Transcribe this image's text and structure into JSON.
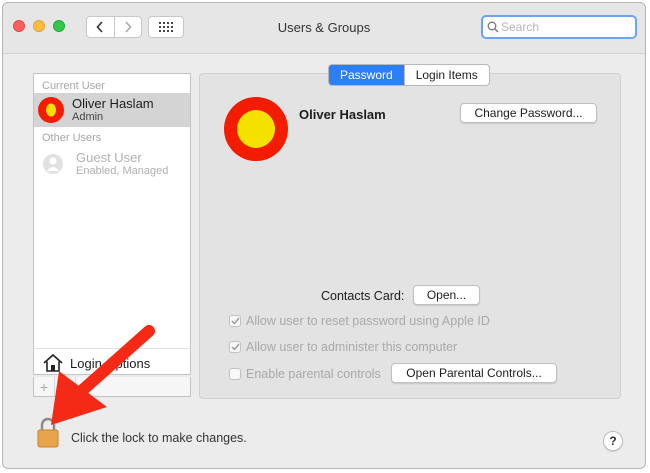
{
  "window": {
    "title": "Users & Groups"
  },
  "search": {
    "placeholder": "Search",
    "value": ""
  },
  "sidebar": {
    "current_header": "Current User",
    "current_user": {
      "name": "Oliver Haslam",
      "role": "Admin"
    },
    "other_header": "Other Users",
    "other_users": [
      {
        "name": "Guest User",
        "role": "Enabled, Managed"
      }
    ],
    "login_options": "Login Options",
    "add_symbol": "+",
    "remove_symbol": "−"
  },
  "tabs": [
    {
      "label": "Password",
      "active": true
    },
    {
      "label": "Login Items",
      "active": false
    }
  ],
  "detail": {
    "user_name": "Oliver Haslam",
    "change_password": "Change Password...",
    "contacts_label": "Contacts Card:",
    "open_button": "Open...",
    "options": [
      {
        "label": "Allow user to reset password using Apple ID",
        "checked": true
      },
      {
        "label": "Allow user to administer this computer",
        "checked": true
      },
      {
        "label": "Enable parental controls",
        "checked": false
      }
    ],
    "parental_button": "Open Parental Controls..."
  },
  "footer": {
    "lock_text": "Click the lock to make changes.",
    "help": "?"
  },
  "icons": {
    "close": "close-button",
    "minimize": "minimize-button",
    "zoom": "zoom-button",
    "back": "chevron-left-icon",
    "forward": "chevron-right-icon",
    "grid": "grid-icon",
    "search": "search-icon",
    "lock": "padlock-icon",
    "home": "house-icon",
    "annotation": "red-arrow"
  },
  "colors": {
    "accent": "#2d7ff5",
    "avatar_outer": "#f41c00",
    "avatar_inner": "#f5e100",
    "arrow": "#f42a17",
    "lock": "#e7a44a"
  }
}
